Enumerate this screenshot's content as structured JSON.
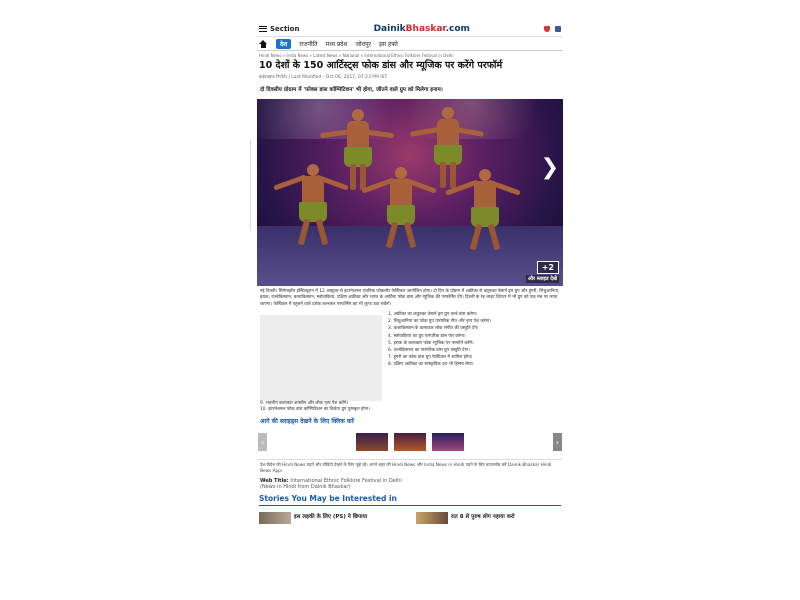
{
  "header": {
    "section_label": "Section",
    "logo_primary": "Dainik",
    "logo_secondary": "Bhaskar",
    "logo_suffix": ".com",
    "notification_count": "1"
  },
  "nav": {
    "items": [
      "देश",
      "राजनीति",
      "मध्य प्रदेश",
      "जोधपुर",
      "इस हफ्ते"
    ]
  },
  "breadcrumb": "Hindi News » India News » Latest News » National » International Ethnic Folklore Festival in Delhi",
  "article": {
    "title": "10 देशों के 150 आर्टिस्ट्स फोक डांस और म्यूजिक पर करेंगे परफॉर्म",
    "meta": "हाईलाइफ रिपोर्टर | Last Modified - Oct 06, 2017, 07:23 PM IST",
    "subtitle": "दो दिवसीय प्रोग्राम में 'फोक्स डांस कॉम्पिटिशन' भी होगा, जीतने वाले ग्रुप को मिलेगा इनाम।",
    "hero_count": "+2",
    "hero_caption": "और स्लाइड देखें",
    "intro": "नई दिल्ली। सिनेमाहॉल इंस्टिट्यूशन में 12 अक्टूबर से इंटरनेशनल एथनिक फोकलोर फेस्टिवल आयोजित होगा। दो दिन के प्रोग्राम में अफ्रीका से कतुरुका वेस्टर्न ड्रम ग्रुप और हुंगरी, लिथुआनिया, इराक, उज्बेकिस्तान, कजाकिस्तान, स्लोवाकिया, दक्षिण अफ्रीका और भारत के आर्टिस्ट फोक डांस और म्यूजिक की परफॉर्मेंस देंगे। दिल्ली के रेड लाइट थिएटर में भी ग्रुप को एक मंच पर लाया जाएगा। फेस्टिवल में पहुंचने वाले दर्शक कल्चरल परफॉर्मेंस का भी लुत्फ उठा सकेंगे।",
    "list_items": [
      "1. अफ्रीका का कतुरुका वेस्टर्न ड्रम ग्रुप वर्ल्ड डांस करेगा।",
      "2. लिथुआनिया का फोक ग्रुप पारंपरिक गीत और नृत्य पेश करेगा।",
      "3. कजाकिस्तान के कलाकार लोक संगीत की प्रस्तुति देंगे।",
      "4. स्लोवाकिया का ग्रुप पारंपरिक डांस पेश करेगा।",
      "5. इराक के कलाकार फोक म्यूजिक पर परफॉर्म करेंगे।",
      "6. उज्बेकिस्तान का पारंपरिक डांस ग्रुप प्रस्तुति देगा।",
      "7. हुंगरी का फोक डांस ग्रुप फेस्टिवल में शामिल होगा।",
      "8. दक्षिण अफ्रीका का सांस्कृतिक दल भी हिस्सा लेगा।"
    ],
    "tail_items": [
      "9. भारतीय कलाकार शास्त्रीय और लोक नृत्य पेश करेंगे।",
      "10. इंटरनेशनल फोक डांस कॉम्पिटिशन का विजेता ग्रुप पुरस्कृत होगा।"
    ],
    "more_slides_link": "आगे की स्लाइड्स देखने के लिए क्लिक करें"
  },
  "footer_note": "देश-विदेश की Hindi News पढ़ने और वीडियो देखने के लिए जुड़े रहें। अपने शहर की Hindi News और India News in Hindi पढ़ने के लिए डाउनलोड करें Dainik Bhaskar Hindi News App।",
  "web_title": {
    "label": "Web Title:",
    "value": "International Ethnic Folklore Festival in Delhi",
    "extra": "(News in Hindi from Dainik Bhaskar)"
  },
  "stories": {
    "heading": "Stories You May be Interested in",
    "items": [
      {
        "title": "इस लड़की के लिए (PS) ने छिपाया"
      },
      {
        "title": "रात 8 से पुरुष लोग नहाया करो"
      }
    ]
  },
  "colors": {
    "brand_blue": "#103a6b",
    "link_blue": "#1a5aa5",
    "accent_red": "#d02a2a",
    "nav_active": "#1a73c8"
  }
}
